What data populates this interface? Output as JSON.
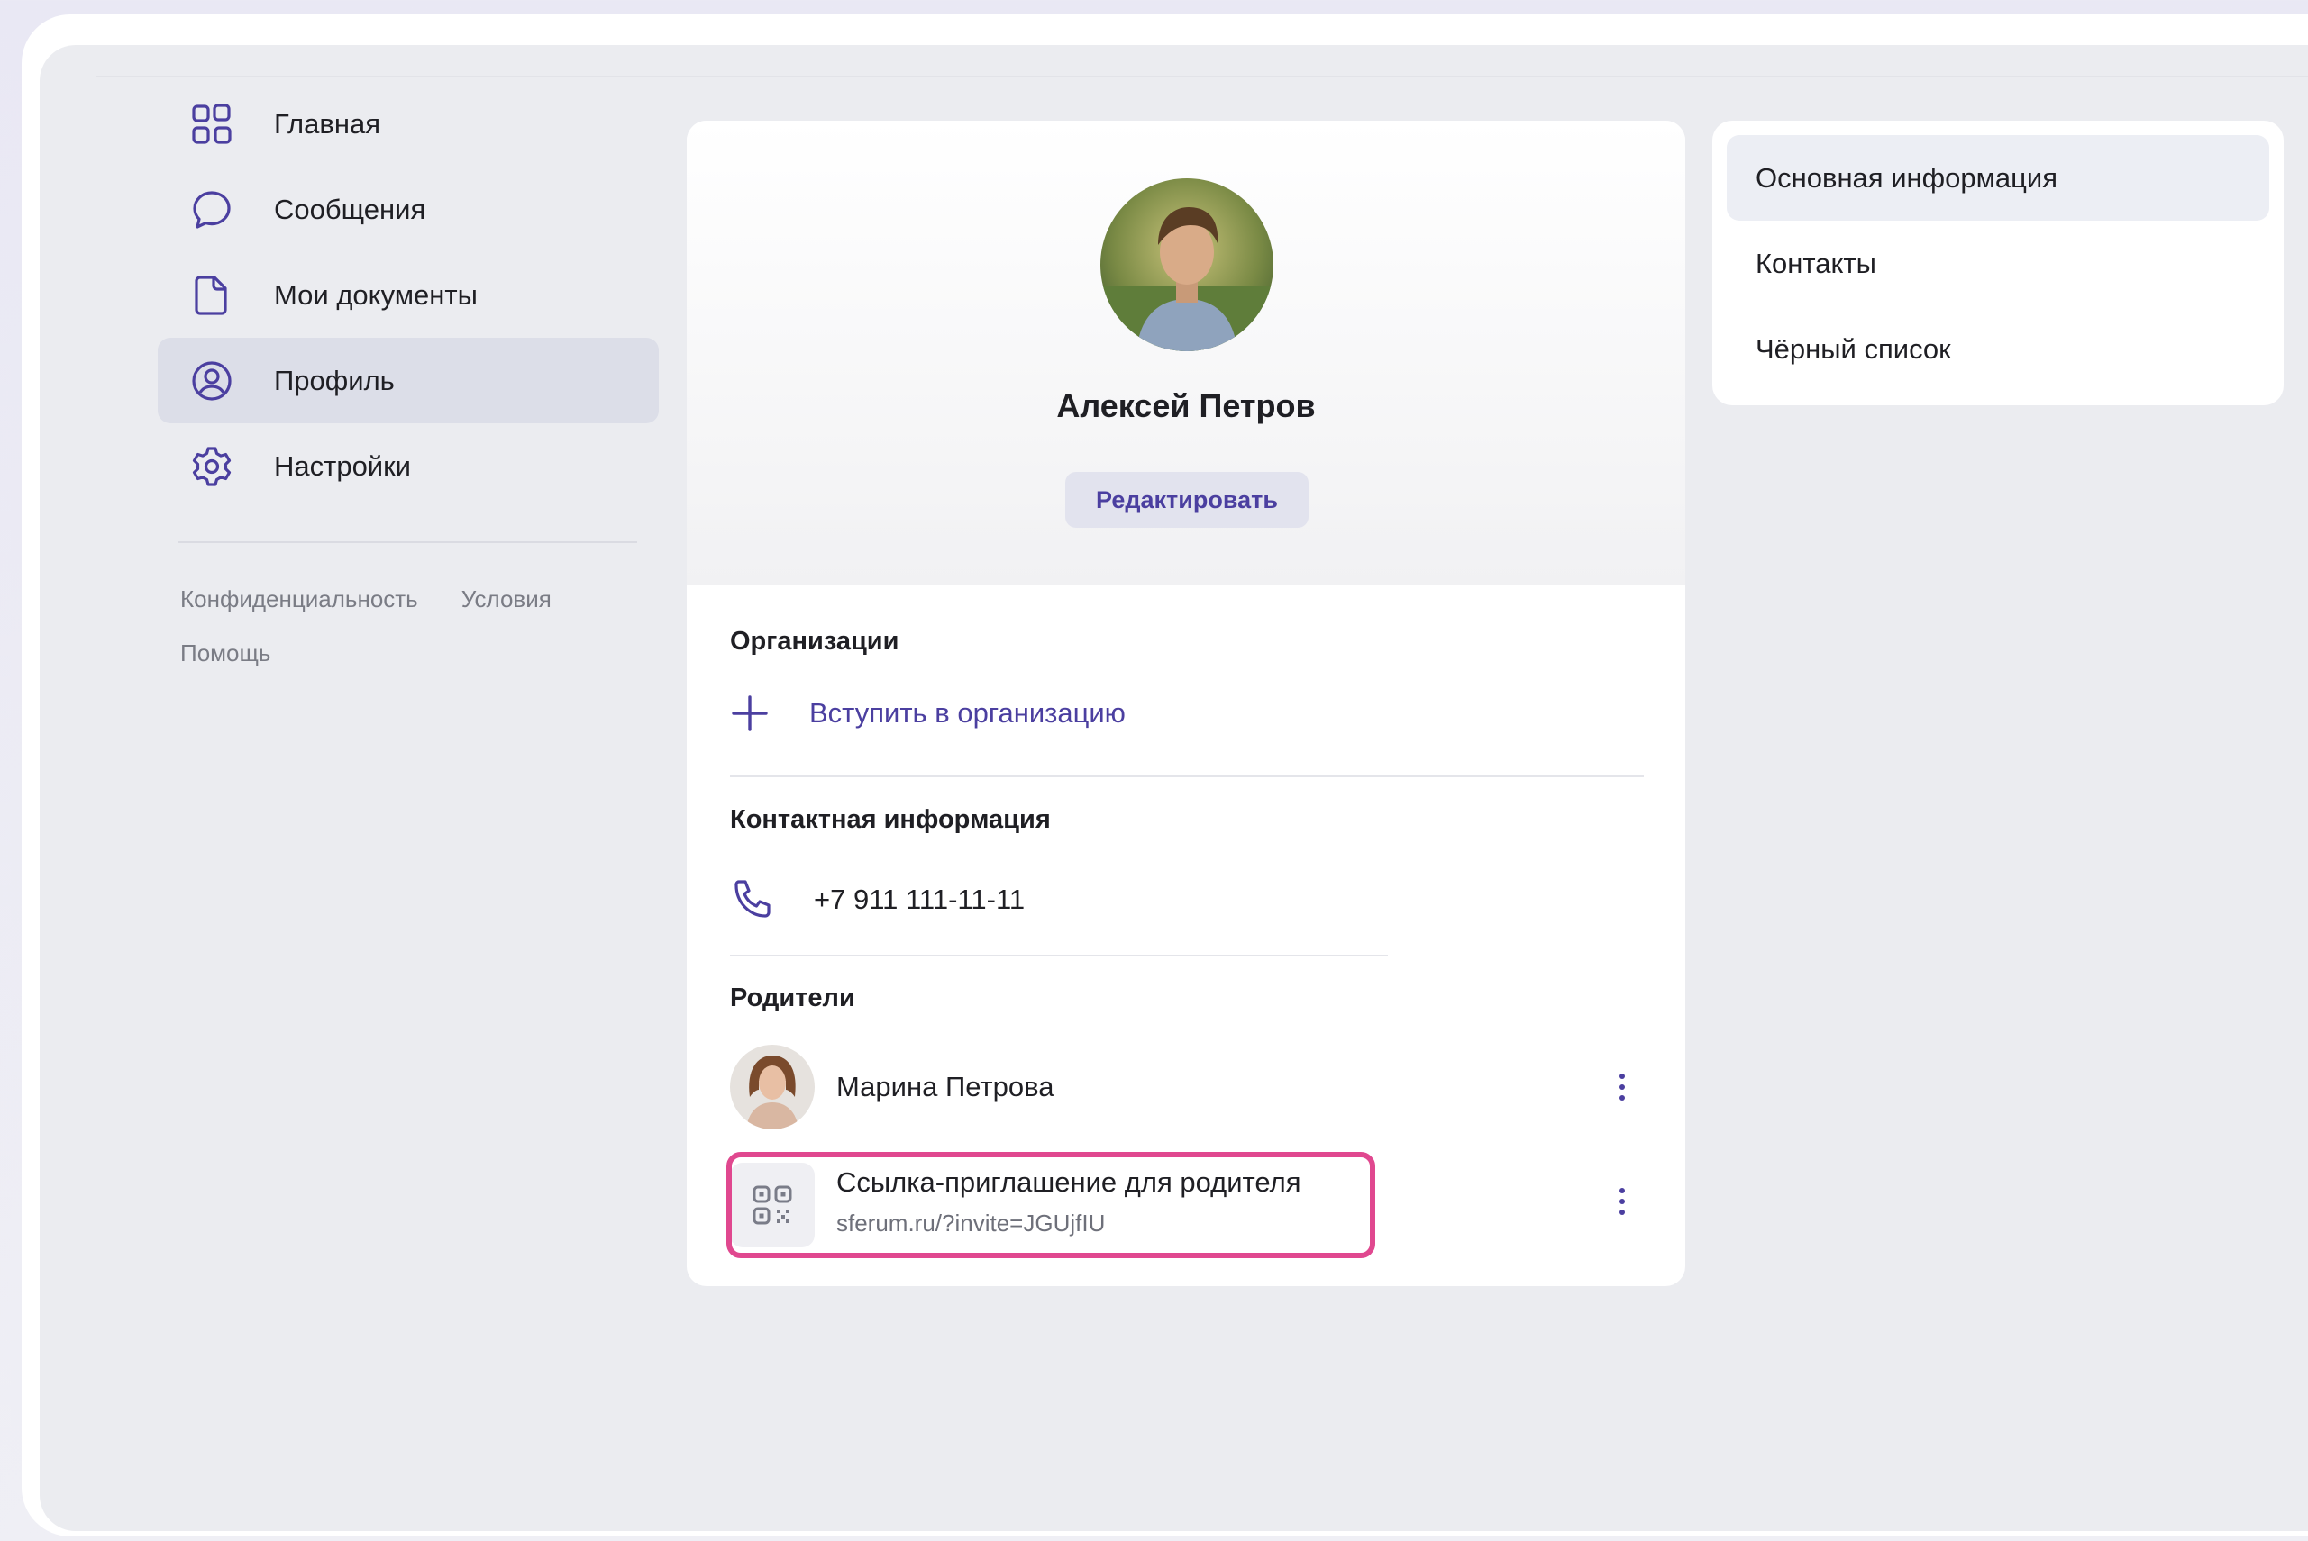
{
  "sidebar": {
    "items": [
      {
        "label": "Главная",
        "icon": "grid-icon",
        "active": false
      },
      {
        "label": "Сообщения",
        "icon": "chat-bubble-icon",
        "active": false
      },
      {
        "label": "Мои документы",
        "icon": "document-icon",
        "active": false
      },
      {
        "label": "Профиль",
        "icon": "user-circle-icon",
        "active": true
      },
      {
        "label": "Настройки",
        "icon": "gear-icon",
        "active": false
      }
    ],
    "footer_links": [
      "Конфиденциальность",
      "Условия",
      "Помощь"
    ]
  },
  "profile": {
    "name": "Алексей Петров",
    "edit_label": "Редактировать"
  },
  "organizations": {
    "title": "Организации",
    "join_label": "Вступить в организацию"
  },
  "contacts": {
    "title": "Контактная информация",
    "phone": "+7 911 111-11-11"
  },
  "parents": {
    "title": "Родители",
    "parent_name": "Марина Петрова",
    "invite_title": "Ссылка-приглашение для родителя",
    "invite_link": "sferum.ru/?invite=JGUjfIU"
  },
  "right_menu": {
    "items": [
      "Основная информация",
      "Контакты",
      "Чёрный список"
    ]
  },
  "colors": {
    "accent": "#4b3fa0",
    "highlight": "#e0488f",
    "background": "#ebecf0"
  }
}
